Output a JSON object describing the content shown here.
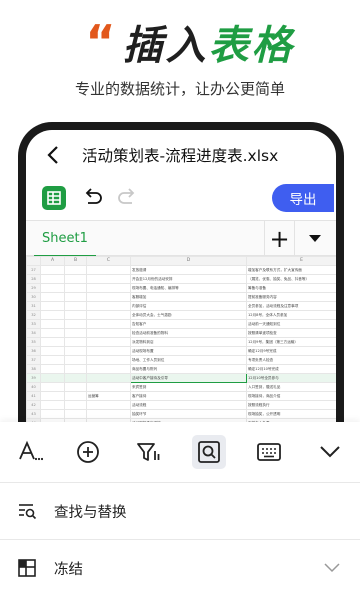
{
  "promo": {
    "quote_mark": "“",
    "headline_part1": "插入",
    "headline_part2": "表格",
    "subline": "专业的数据统计，让办公更简单"
  },
  "app": {
    "document_title": "活动策划表-流程进度表.xlsx",
    "export_label": "导出",
    "sheet_tab_label": "Sheet1",
    "add_sheet_symbol": "+"
  },
  "grid": {
    "column_headers": [
      "A",
      "B",
      "C",
      "D",
      "E"
    ],
    "rows": [
      {
        "num": "27",
        "c": "",
        "d": "发放邀请",
        "e": "增加客户及联系方式，扩大宣传面"
      },
      {
        "num": "28",
        "c": "",
        "d": "开会至12月份的活动安排",
        "e": "（展览、优惠、抽奖、免品、抖音等）"
      },
      {
        "num": "29",
        "c": "",
        "d": "现场布置、电话通知、编排等",
        "e": "筹备与准备"
      },
      {
        "num": "30",
        "c": "",
        "d": "客服增加",
        "e": "提前准备服务内容"
      },
      {
        "num": "31",
        "c": "",
        "d": "内部评估",
        "e": "全员参加，活动流程及注意事项"
      },
      {
        "num": "32",
        "c": "",
        "d": "全体动员大会，士气激励",
        "e": "12月8号，全体人员参加"
      },
      {
        "num": "33",
        "c": "",
        "d": "告知客户",
        "e": "活动前一天通知到位"
      },
      {
        "num": "34",
        "c": "",
        "d": "检查活动前准备的物料",
        "e": "按照清单逐项检查"
      },
      {
        "num": "35",
        "c": "",
        "d": "派发物料到店",
        "e": "12月9号，集团（第三方运输）"
      },
      {
        "num": "36",
        "c": "",
        "d": "活动现场布置",
        "e": "确定12月9号完成"
      },
      {
        "num": "37",
        "c": "",
        "d": "场地、工作人员到位",
        "e": "专项负责人检查"
      },
      {
        "num": "38",
        "c": "",
        "d": "商品布置与陈列",
        "e": "确定12月10号完成"
      },
      {
        "num": "39",
        "c": "",
        "d": "活动中客户接待及引导",
        "e": "12月10号全员参与",
        "sel": true
      },
      {
        "num": "40",
        "c": "",
        "d": "来宾签到",
        "e": "入口签到，赠送礼品"
      },
      {
        "num": "41",
        "c": "运营筹",
        "d": "客户接待",
        "e": "现场接待，商品介绍"
      },
      {
        "num": "42",
        "c": "",
        "d": "活动流程",
        "e": "按照流程执行"
      },
      {
        "num": "43",
        "c": "",
        "d": "抽奖环节",
        "e": "现场抽奖，公开透明"
      },
      {
        "num": "44",
        "c": "",
        "d": "活动现场秩序维护",
        "e": "安排专人负责"
      },
      {
        "num": "45",
        "c": "",
        "d": "活动结束",
        "e": "整理现场，总结反馈"
      }
    ]
  },
  "tools": {
    "text_format_icon": "text-format-icon",
    "insert_icon": "add-circle-icon",
    "filter_icon": "filter-icon",
    "find_icon": "find-replace-icon",
    "keyboard_icon": "keyboard-icon",
    "collapse_icon": "chevron-down-icon"
  },
  "menu": {
    "find_replace_label": "查找与替换",
    "freeze_label": "冻结"
  },
  "colors": {
    "brand_green": "#1f9d43",
    "accent_orange": "#e2581c",
    "export_blue": "#3f5ef0"
  }
}
